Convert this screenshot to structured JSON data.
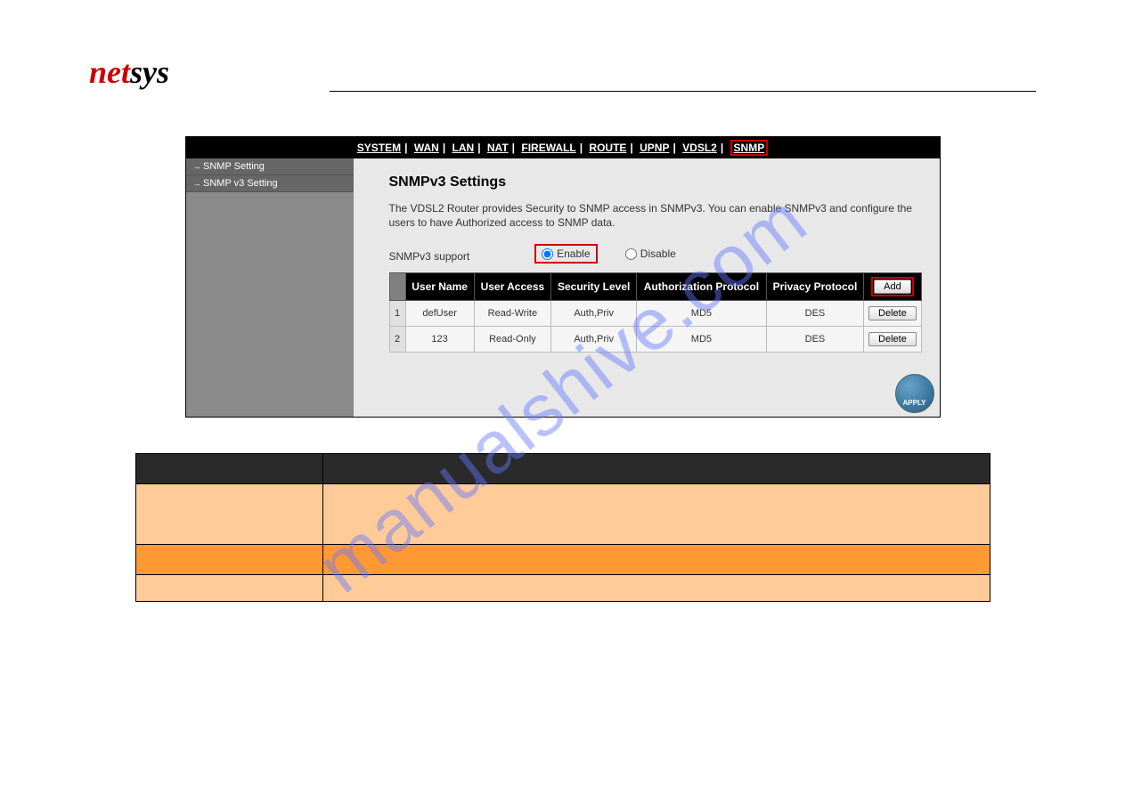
{
  "logo": {
    "part1": "net",
    "part2": "sys"
  },
  "watermark": "manualshive.com",
  "topnav": {
    "items": [
      "SYSTEM",
      "WAN",
      "LAN",
      "NAT",
      "FIREWALL",
      "ROUTE",
      "UPNP",
      "VDSL2",
      "SNMP"
    ],
    "active": "SNMP"
  },
  "sidebar": {
    "items": [
      {
        "label": "SNMP Setting"
      },
      {
        "label": "SNMP v3 Setting"
      }
    ]
  },
  "content": {
    "title": "SNMPv3 Settings",
    "description": "The VDSL2 Router provides Security to SNMP access in SNMPv3. You can enable SNMPv3 and configure the users to have Authorized access to SNMP data.",
    "support_label": "SNMPv3 support",
    "enable": "Enable",
    "disable": "Disable",
    "selected": "Enable"
  },
  "table": {
    "headers": [
      "User Name",
      "User Access",
      "Security Level",
      "Authorization Protocol",
      "Privacy Protocol"
    ],
    "add_label": "Add",
    "delete_label": "Delete",
    "rows": [
      {
        "idx": "1",
        "user": "defUser",
        "access": "Read-Write",
        "sec": "Auth,Priv",
        "auth": "MD5",
        "priv": "DES"
      },
      {
        "idx": "2",
        "user": "123",
        "access": "Read-Only",
        "sec": "Auth,Priv",
        "auth": "MD5",
        "priv": "DES"
      }
    ]
  },
  "apply": "APPLY"
}
